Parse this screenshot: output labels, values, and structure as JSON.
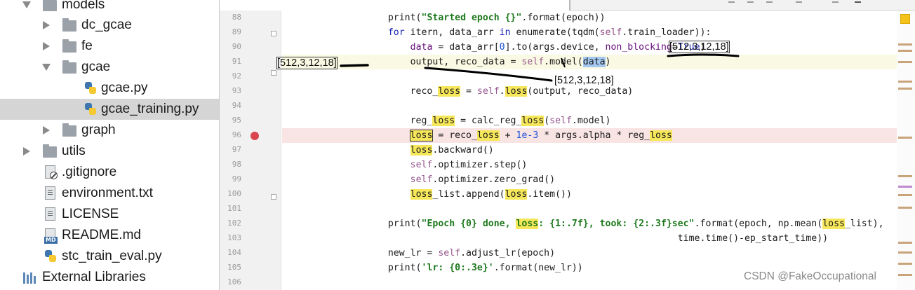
{
  "tree": {
    "items": [
      {
        "label": "models",
        "kind": "folder",
        "expanded": true
      },
      {
        "label": "dc_gcae",
        "kind": "folder",
        "expanded": false
      },
      {
        "label": "fe",
        "kind": "folder",
        "expanded": false
      },
      {
        "label": "gcae",
        "kind": "folder",
        "expanded": true
      },
      {
        "label": "gcae.py",
        "kind": "python"
      },
      {
        "label": "gcae_training.py",
        "kind": "python",
        "selected": true
      },
      {
        "label": "graph",
        "kind": "folder",
        "expanded": false
      },
      {
        "label": "utils",
        "kind": "folder",
        "expanded": false
      },
      {
        "label": ".gitignore",
        "kind": "ignore"
      },
      {
        "label": "environment.txt",
        "kind": "text"
      },
      {
        "label": "LICENSE",
        "kind": "text"
      },
      {
        "label": "README.md",
        "kind": "markdown",
        "badge": "MD"
      },
      {
        "label": "stc_train_eval.py",
        "kind": "python"
      },
      {
        "label": "External Libraries",
        "kind": "library"
      }
    ]
  },
  "editor": {
    "line_numbers": [
      "88",
      "89",
      "90",
      "91",
      "92",
      "93",
      "94",
      "95",
      "96",
      "97",
      "98",
      "99",
      "100",
      "101",
      "102",
      "103",
      "104",
      "105",
      "106"
    ],
    "breakpoint_line": "96",
    "current_line": "91"
  },
  "annotations": {
    "shape_line90": "[512,3,12,18]",
    "shape_left91": "[512,3,12,18]",
    "shape_below91": "[512,3,12,18]"
  },
  "watermark": "CSDN @FakeOccupational",
  "colors": {
    "keyword": "#1a27b5",
    "string": "#1f7a1f",
    "self": "#94558d",
    "number": "#1a50d6",
    "highlight": "#f6e75a",
    "breakpoint": "#d8454e",
    "selection": "#a4c8f0"
  }
}
